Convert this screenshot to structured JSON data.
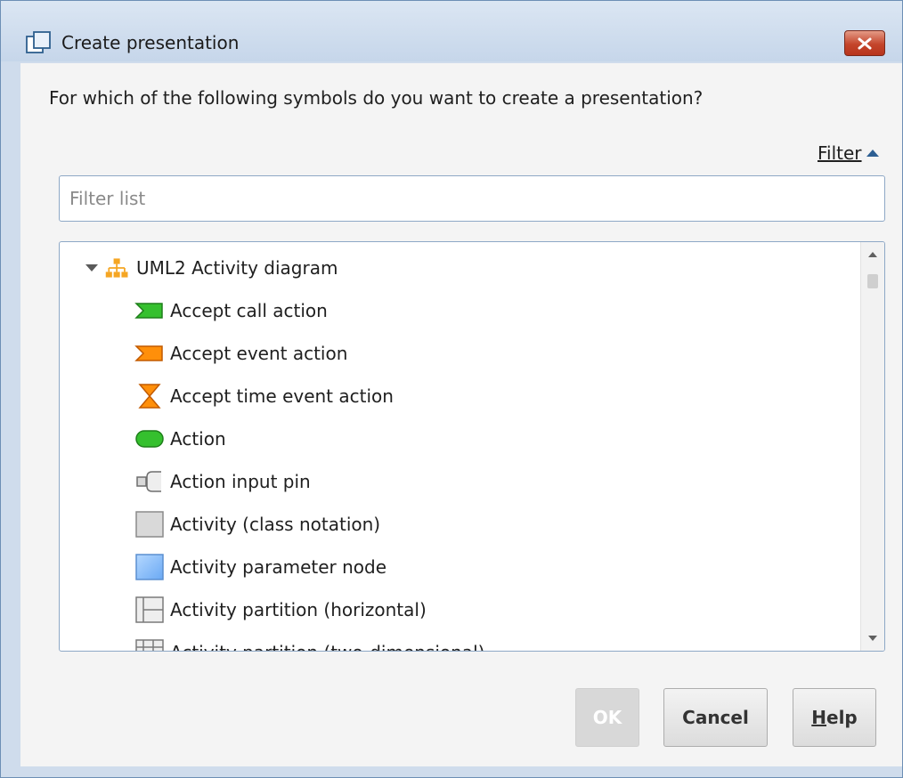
{
  "window": {
    "title": "Create presentation",
    "icon": "window-icon",
    "close_icon": "close-x-icon"
  },
  "prompt": "For which of the following symbols do you want to create a presentation?",
  "filter": {
    "toggle_label": "Filter",
    "toggle_icon": "triangle-up-icon",
    "placeholder": "Filter list",
    "value": ""
  },
  "tree": {
    "root": {
      "label": "UML2 Activity diagram",
      "icon": "hierarchy-icon",
      "expanded": true
    },
    "items": [
      {
        "label": "Accept call action",
        "icon": "accept-call-action-icon"
      },
      {
        "label": "Accept event action",
        "icon": "accept-event-action-icon"
      },
      {
        "label": "Accept time event action",
        "icon": "hourglass-icon"
      },
      {
        "label": "Action",
        "icon": "action-icon"
      },
      {
        "label": "Action input pin",
        "icon": "input-pin-icon"
      },
      {
        "label": "Activity (class notation)",
        "icon": "activity-class-icon"
      },
      {
        "label": "Activity parameter node",
        "icon": "parameter-node-icon"
      },
      {
        "label": "Activity partition (horizontal)",
        "icon": "partition-horizontal-icon"
      },
      {
        "label": "Activity partition (two-dimensional)",
        "icon": "partition-2d-icon"
      }
    ]
  },
  "buttons": {
    "ok": "OK",
    "cancel": "Cancel",
    "help_mnemonic": "H",
    "help_rest": "elp"
  },
  "colors": {
    "title_bg": "#c6d6ea",
    "close_red": "#c4452b",
    "green": "#2fbf2a",
    "orange": "#ff8a00",
    "blue": "#8ec2ff"
  }
}
